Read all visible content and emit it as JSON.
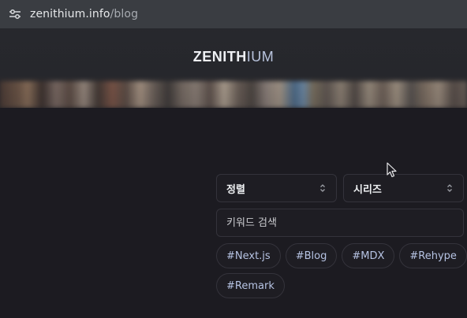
{
  "browser": {
    "url_host": "zenithium.info",
    "url_path": "/blog"
  },
  "header": {
    "brand_part1": "ZENITH",
    "brand_part2": "IUM"
  },
  "filters": {
    "sort_label": "정렬",
    "series_label": "시리즈",
    "search_placeholder": "키워드 검색",
    "search_value": ""
  },
  "tags": [
    "#Next.js",
    "#Blog",
    "#MDX",
    "#Rehype",
    "#Remark"
  ],
  "colors": {
    "page_bg": "#1c1b21",
    "address_bar_bg": "#3a3d42",
    "tag_text": "#b6c3e3",
    "border": "#34333b"
  },
  "icons": {
    "site_info": "tune-icon",
    "select_chevron": "chevron-up-down-icon",
    "cursor": "mouse-pointer-icon"
  }
}
